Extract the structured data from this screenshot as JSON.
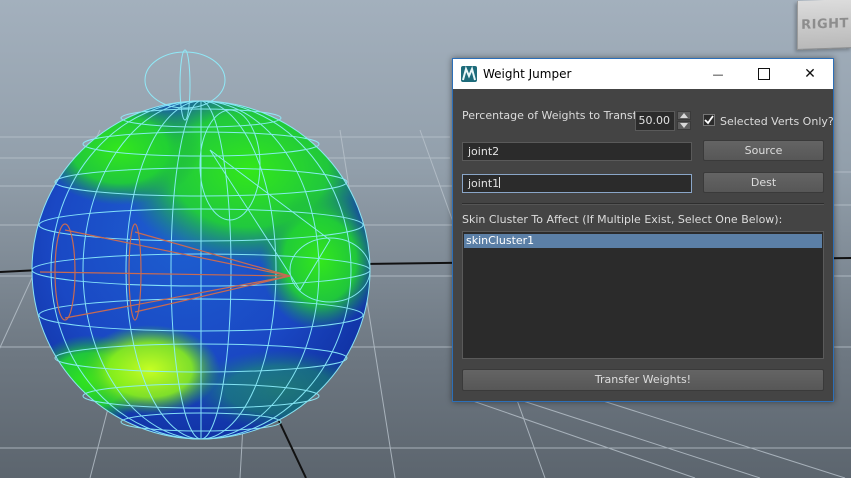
{
  "viewport": {
    "view_cube_label": "RIGHT",
    "view_cube_icon": "view-cube-icon"
  },
  "window": {
    "title": "Weight Jumper",
    "icon": "maya-app-icon",
    "minimize_glyph": "—",
    "maximize_glyph": "☐",
    "close_glyph": "✕"
  },
  "form": {
    "percentage_label": "Percentage of Weights to Transfer",
    "percentage_value": "50.00",
    "selected_verts_label": "Selected Verts Only?",
    "selected_verts_checked": true,
    "source_value": "joint2",
    "source_button": "Source",
    "dest_value": "joint1",
    "dest_button": "Dest",
    "skin_cluster_label": "Skin Cluster To Affect (If Multiple Exist, Select One Below):",
    "skin_clusters": [
      "skinCluster1"
    ],
    "transfer_button": "Transfer Weights!"
  },
  "colors": {
    "accent_border": "#2c6fb8",
    "selection": "#5b7fa6",
    "panel_bg": "#444444"
  }
}
